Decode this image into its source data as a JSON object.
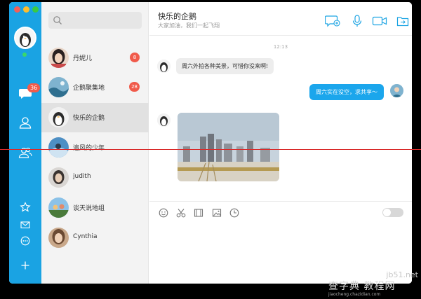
{
  "colors": {
    "accent": "#1aa3e3",
    "badge": "#f05a4a",
    "bubble_out": "#1ba6ec",
    "redline": "#d92b2b"
  },
  "sidebar": {
    "unread_badge": "36",
    "icons": [
      "chat-icon",
      "contact-icon",
      "group-icon",
      "star-icon",
      "mail-icon",
      "more-icon",
      "add-icon"
    ]
  },
  "contacts": [
    {
      "name": "丹妮儿",
      "count": "8"
    },
    {
      "name": "企鹅聚集地",
      "count": "28"
    },
    {
      "name": "快乐的企鹅",
      "count": ""
    },
    {
      "name": "追风的少年",
      "count": ""
    },
    {
      "name": "judith",
      "count": ""
    },
    {
      "name": "谈天说地组",
      "count": ""
    },
    {
      "name": "Cynthia",
      "count": ""
    }
  ],
  "chat": {
    "title": "快乐的企鹅",
    "subtitle": "大家加油，我们一起飞翔",
    "time": "12:13",
    "incoming_message": "周六外拍各种美景，可惜你没来啊!",
    "outgoing_message": "周六实在没空，求共享～",
    "header_icons": [
      "add-chat-icon",
      "microphone-icon",
      "video-icon",
      "share-icon"
    ],
    "toolbar_icons": [
      "emoji-icon",
      "scissors-icon",
      "film-icon",
      "image-icon",
      "clock-icon"
    ]
  },
  "watermark": {
    "line1": "jb51.net",
    "line2": "查字典 教程网",
    "line3": "jiaocheng.chazidian.com"
  }
}
